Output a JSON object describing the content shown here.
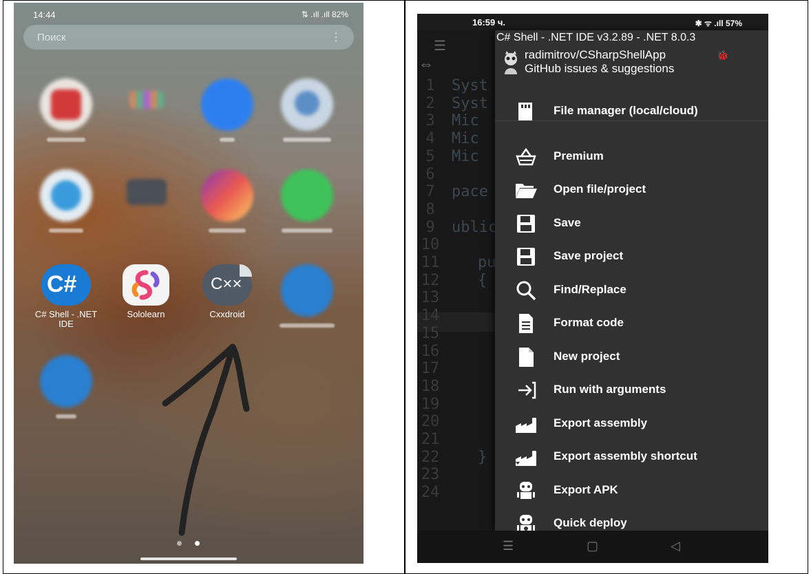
{
  "left": {
    "status_time": "14:44",
    "status_right": "⇅ .ıll .ıll 82%",
    "search_placeholder": "Поиск",
    "apps": [
      {
        "label": "C# Shell - .NET IDE"
      },
      {
        "label": "Sololearn"
      },
      {
        "label": "Cxxdroid"
      }
    ],
    "cxx_icon_text": "C××",
    "csharp_icon_text": "C#"
  },
  "right": {
    "status_time": "16:59 ч.",
    "status_right": "✱ ᯤ .ıll 57%",
    "drawer": {
      "title": "C# Shell - .NET IDE v3.2.89 - .NET 8.0.3",
      "user": "radimitrov/CSharpShellApp",
      "link": "GitHub issues & suggestions",
      "items": [
        {
          "label": "File manager (local/cloud)",
          "icon": "sd-card-icon"
        },
        {
          "label": "Premium",
          "icon": "basket-icon"
        },
        {
          "label": "Open file/project",
          "icon": "folder-open-icon"
        },
        {
          "label": "Save",
          "icon": "floppy-icon"
        },
        {
          "label": "Save project",
          "icon": "floppy-icon"
        },
        {
          "label": "Find/Replace",
          "icon": "search-icon"
        },
        {
          "label": "Format code",
          "icon": "document-icon"
        },
        {
          "label": "New project",
          "icon": "new-file-icon"
        },
        {
          "label": "Run with arguments",
          "icon": "run-arrow-icon"
        },
        {
          "label": "Export assembly",
          "icon": "factory-icon"
        },
        {
          "label": "Export assembly shortcut",
          "icon": "factory-shortcut-icon"
        },
        {
          "label": "Export APK",
          "icon": "android-robot-icon"
        },
        {
          "label": "Quick deploy",
          "icon": "robot-deploy-icon"
        }
      ]
    },
    "code_lines": [
      {
        "n": "1",
        "t": "Syst"
      },
      {
        "n": "2",
        "t": "Syst"
      },
      {
        "n": "3",
        "t": "Mic"
      },
      {
        "n": "4",
        "t": "Mic"
      },
      {
        "n": "5",
        "t": "Mic"
      },
      {
        "n": "6",
        "t": ""
      },
      {
        "n": "7",
        "t": "pace"
      },
      {
        "n": "8",
        "t": ""
      },
      {
        "n": "9",
        "t": "ublic"
      },
      {
        "n": "10",
        "t": ""
      },
      {
        "n": "11",
        "t": "pu"
      },
      {
        "n": "12",
        "t": "{"
      },
      {
        "n": "13",
        "t": ""
      },
      {
        "n": "14",
        "t": ""
      },
      {
        "n": "15",
        "t": ""
      },
      {
        "n": "16",
        "t": ""
      },
      {
        "n": "17",
        "t": ""
      },
      {
        "n": "18",
        "t": ""
      },
      {
        "n": "19",
        "t": ""
      },
      {
        "n": "20",
        "t": ""
      },
      {
        "n": "21",
        "t": ""
      },
      {
        "n": "22",
        "t": "}"
      },
      {
        "n": "23",
        "t": ""
      },
      {
        "n": "24",
        "t": ""
      }
    ]
  }
}
